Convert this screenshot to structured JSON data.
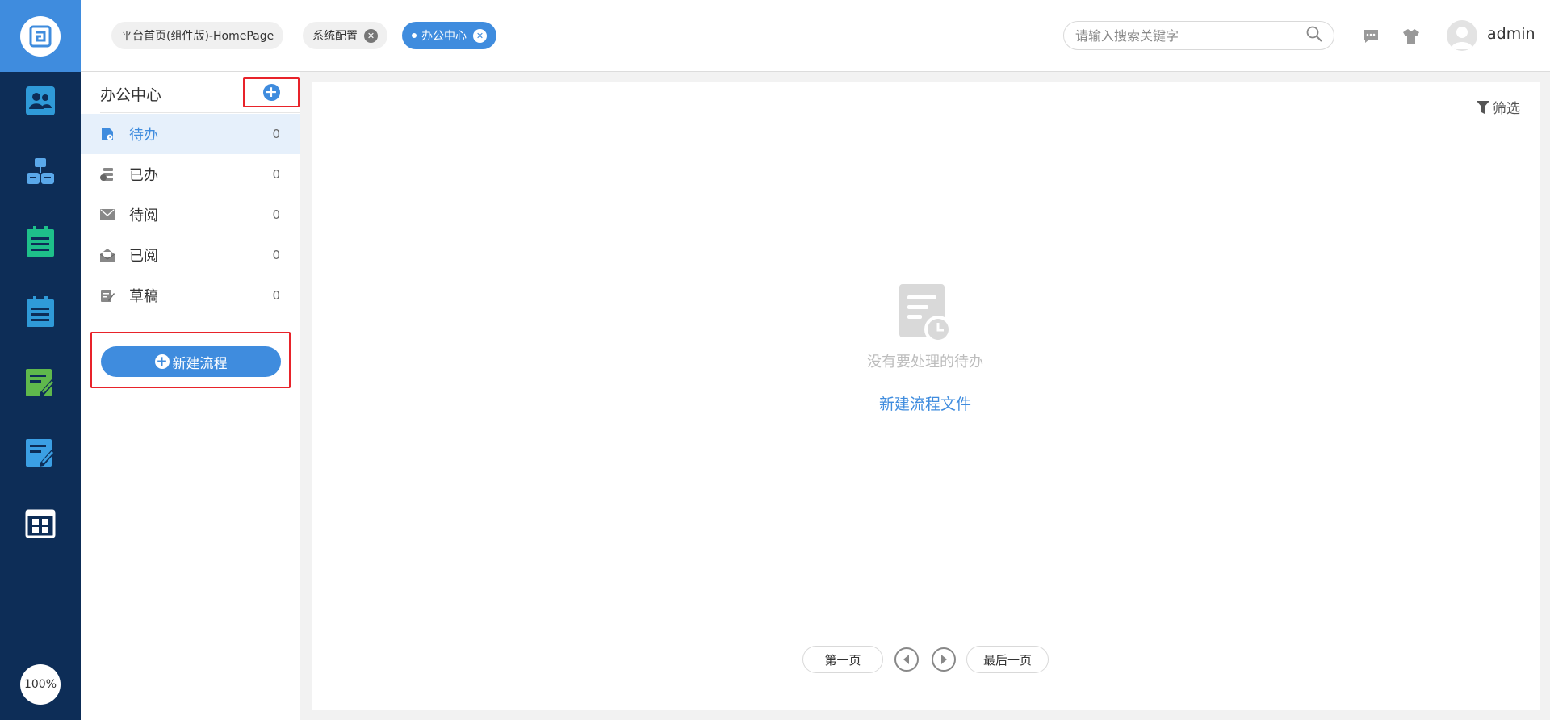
{
  "rail": {
    "zoom_label": "100%",
    "items": [
      {
        "icon": "users-icon"
      },
      {
        "icon": "org-chart-icon"
      },
      {
        "icon": "clipboard-icon"
      },
      {
        "icon": "clipboard-list-icon"
      },
      {
        "icon": "edit-document-icon"
      },
      {
        "icon": "edit-form-icon"
      },
      {
        "icon": "app-grid-icon"
      }
    ]
  },
  "tabs": [
    {
      "label": "平台首页(组件版)-HomePage"
    },
    {
      "label": "系统配置"
    },
    {
      "label": "办公中心"
    }
  ],
  "header": {
    "search_placeholder": "请输入搜索关键字",
    "username": "admin"
  },
  "sidebar": {
    "title": "办公中心",
    "items": [
      {
        "label": "待办",
        "count": "0",
        "icon": "todo-doc-icon"
      },
      {
        "label": "已办",
        "count": "0",
        "icon": "done-stack-icon"
      },
      {
        "label": "待阅",
        "count": "0",
        "icon": "mail-icon"
      },
      {
        "label": "已阅",
        "count": "0",
        "icon": "mail-open-icon"
      },
      {
        "label": "草稿",
        "count": "0",
        "icon": "draft-icon"
      }
    ],
    "new_flow_label": "新建流程"
  },
  "main": {
    "filter_label": "筛选",
    "empty_text": "没有要处理的待办",
    "empty_link": "新建流程文件",
    "pager": {
      "first": "第一页",
      "last": "最后一页"
    }
  },
  "colors": {
    "accent": "#3f8cde",
    "rail_bg": "#0d2d57",
    "highlight_frame": "#e8232a"
  }
}
